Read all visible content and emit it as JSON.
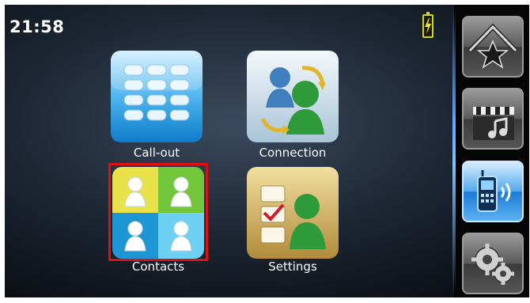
{
  "status": {
    "time": "21:58"
  },
  "apps": [
    {
      "id": "call-out",
      "label": "Call-out",
      "icon": "dialpad-icon"
    },
    {
      "id": "connection",
      "label": "Connection",
      "icon": "connection-icon"
    },
    {
      "id": "contacts",
      "label": "Contacts",
      "icon": "contacts-icon",
      "highlighted": true
    },
    {
      "id": "settings",
      "label": "Settings",
      "icon": "settings-checklist-icon"
    }
  ],
  "sidebar": [
    {
      "name": "home",
      "icon": "home-star-icon"
    },
    {
      "name": "media",
      "icon": "media-clapper-icon"
    },
    {
      "name": "phone",
      "icon": "phone-bluetooth-icon",
      "active": true
    },
    {
      "name": "settings",
      "icon": "gears-icon"
    }
  ],
  "colors": {
    "highlight": "#e01010",
    "active_sidebar": "#2a8ae6",
    "battery": "#cfd22a"
  }
}
